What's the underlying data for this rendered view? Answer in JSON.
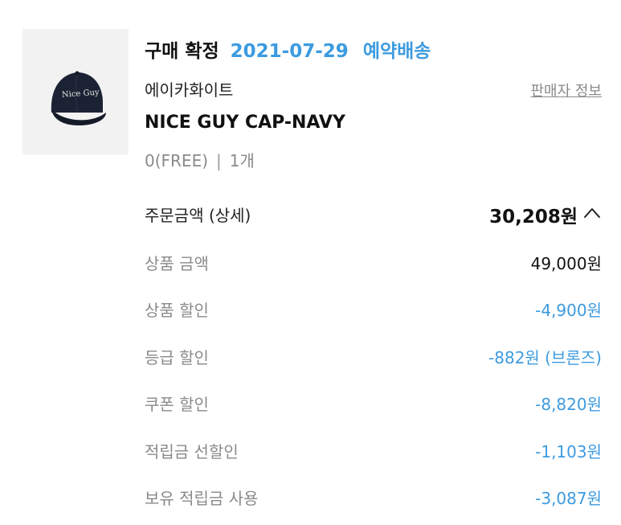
{
  "order": {
    "status_label": "구매 확정",
    "date": "2021-07-29",
    "shipping_type": "예약배송",
    "brand": "에이카화이트",
    "seller_link": "판매자 정보",
    "product_name": "NICE GUY CAP-NAVY",
    "product_image_text": "Nice Guy",
    "option": "0(FREE)",
    "separator": "|",
    "quantity": "1개"
  },
  "summary": {
    "order_amount_label": "주문금액 (상세)",
    "order_amount": "30,208원",
    "toggle_icon": "chevron-up-icon",
    "rows": [
      {
        "label": "상품 금액",
        "value": "49,000원",
        "tone": "dark"
      },
      {
        "label": "상품 할인",
        "value": "-4,900원",
        "tone": "blue"
      },
      {
        "label": "등급 할인",
        "value": "-882원 (브론즈)",
        "tone": "blue"
      },
      {
        "label": "쿠폰 할인",
        "value": "-8,820원",
        "tone": "blue"
      },
      {
        "label": "적립금 선할인",
        "value": "-1,103원",
        "tone": "blue"
      },
      {
        "label": "보유 적립금 사용",
        "value": "-3,087원",
        "tone": "blue"
      }
    ]
  },
  "colors": {
    "accent_blue": "#3d9be0",
    "muted_gray": "#8a8a8a",
    "text_dark": "#111111",
    "thumb_bg": "#f2f2f2",
    "cap_navy": "#1b2233"
  }
}
